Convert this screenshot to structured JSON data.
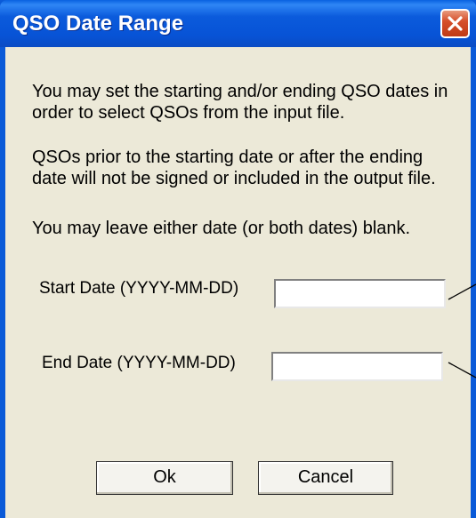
{
  "window": {
    "title": "QSO Date Range"
  },
  "instructions": {
    "paragraph1": "You may set the starting and/or ending QSO dates in order to select QSOs from the input file.",
    "paragraph2": "QSOs prior to the starting date or after the ending date will not be signed or included in the output file.",
    "paragraph3": "You may leave either date (or both dates) blank."
  },
  "form": {
    "start_label": "Start Date (YYYY-MM-DD)",
    "start_value": "",
    "end_label": "End Date (YYYY-MM-DD)",
    "end_value": ""
  },
  "buttons": {
    "ok_label": "Ok",
    "cancel_label": "Cancel"
  },
  "icons": {
    "close": "close-icon"
  },
  "colors": {
    "titlebar": "#0753d6",
    "dialog_background": "#ece9d8",
    "close_button": "#d6502c"
  }
}
